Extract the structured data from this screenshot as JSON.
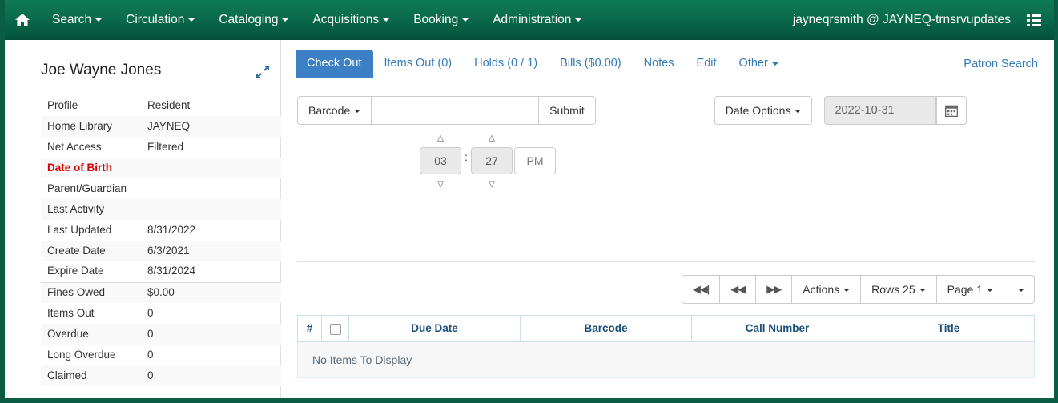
{
  "navbar": {
    "home_icon": "home-icon",
    "menu_icon": "list-menu-icon",
    "items": [
      {
        "label": "Search",
        "has_caret": true
      },
      {
        "label": "Circulation",
        "has_caret": true
      },
      {
        "label": "Cataloging",
        "has_caret": true
      },
      {
        "label": "Acquisitions",
        "has_caret": true
      },
      {
        "label": "Booking",
        "has_caret": true
      },
      {
        "label": "Administration",
        "has_caret": true
      }
    ],
    "user": "jayneqrsmith @ JAYNEQ-trnsrvupdates",
    "bg_color": "#0a6b4b"
  },
  "sidebar": {
    "patron_name": "Joe Wayne Jones",
    "pin_icon": "collapse-arrows-icon",
    "rows": [
      {
        "label": "Profile",
        "value": "Resident",
        "alert": false
      },
      {
        "label": "Home Library",
        "value": "JAYNEQ",
        "alert": false
      },
      {
        "label": "Net Access",
        "value": "Filtered",
        "alert": false
      },
      {
        "label": "Date of Birth",
        "value": "",
        "alert": true
      },
      {
        "label": "Parent/Guardian",
        "value": "",
        "alert": false
      },
      {
        "label": "Last Activity",
        "value": "",
        "alert": false
      },
      {
        "label": "Last Updated",
        "value": "8/31/2022",
        "alert": false
      },
      {
        "label": "Create Date",
        "value": "6/3/2021",
        "alert": false
      },
      {
        "label": "Expire Date",
        "value": "8/31/2024",
        "alert": false
      },
      {
        "label": "Fines Owed",
        "value": "$0.00",
        "alert": false
      },
      {
        "label": "Items Out",
        "value": "0",
        "alert": false
      },
      {
        "label": "Overdue",
        "value": "0",
        "alert": false
      },
      {
        "label": "Long Overdue",
        "value": "0",
        "alert": false
      },
      {
        "label": "Claimed",
        "value": "0",
        "alert": false
      }
    ]
  },
  "tabs": [
    {
      "label": "Check Out",
      "active": true
    },
    {
      "label": "Items Out (0)",
      "active": false
    },
    {
      "label": "Holds (0 / 1)",
      "active": false
    },
    {
      "label": "Bills ($0.00)",
      "active": false
    },
    {
      "label": "Notes",
      "active": false
    },
    {
      "label": "Edit",
      "active": false
    },
    {
      "label": "Other",
      "active": false,
      "has_caret": true
    }
  ],
  "patron_search_link": "Patron Search",
  "checkout": {
    "barcode_type_label": "Barcode",
    "barcode_value": "",
    "barcode_placeholder": "",
    "submit_label": "Submit",
    "date_options_label": "Date Options",
    "due_date_value": "2022-10-31",
    "calendar_icon": "calendar-icon",
    "time": {
      "hour": "03",
      "minute": "27",
      "meridiem": "PM",
      "separator": ":"
    }
  },
  "grid": {
    "toolbar": {
      "first_page_icon": "first-page-icon",
      "prev_page_icon": "previous-page-icon",
      "next_page_icon": "next-page-icon",
      "actions_label": "Actions",
      "rows_label": "Rows 25",
      "page_label": "Page 1",
      "extra_menu_icon": "caret-down-icon"
    },
    "columns": [
      "#",
      "",
      "Due Date",
      "Barcode",
      "Call Number",
      "Title"
    ],
    "rows": [],
    "empty_message": "No Items To Display"
  },
  "colors": {
    "brand_green": "#0a6b4b",
    "accent_blue": "#337ab7",
    "active_tab_blue": "#3b80c4",
    "alert_red": "#dd0000",
    "grid_header_text": "#1c4e7a"
  }
}
